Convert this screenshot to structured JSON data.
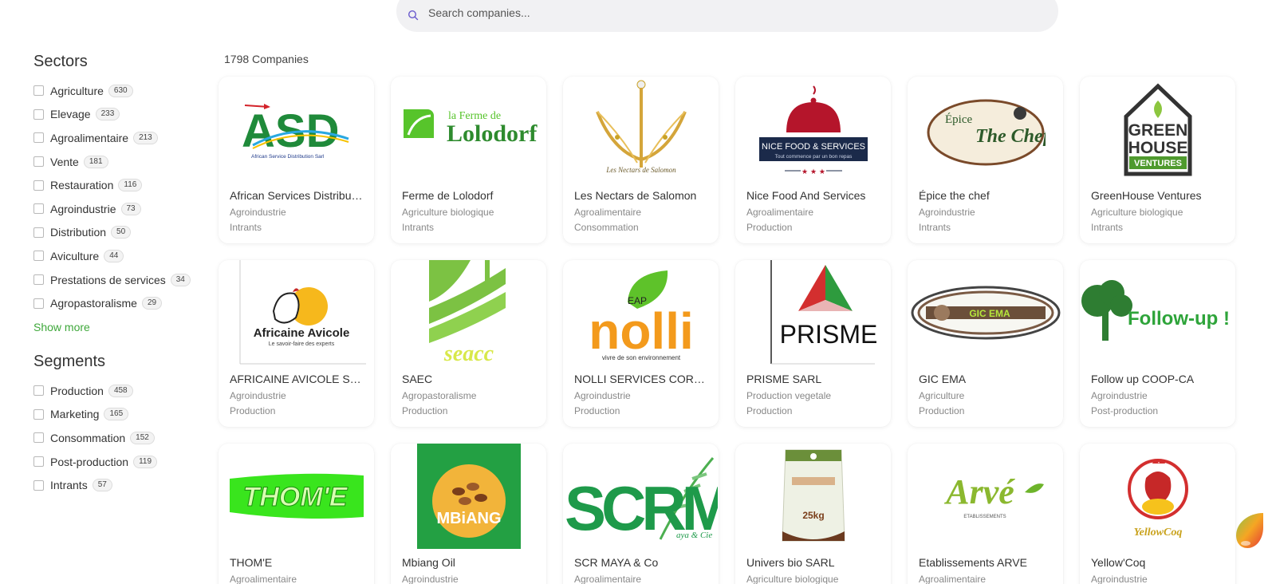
{
  "search": {
    "placeholder": "Search companies..."
  },
  "sidebar": {
    "sectors_title": "Sectors",
    "sectors": [
      {
        "label": "Agriculture",
        "count": "630"
      },
      {
        "label": "Elevage",
        "count": "233"
      },
      {
        "label": "Agroalimentaire",
        "count": "213"
      },
      {
        "label": "Vente",
        "count": "181"
      },
      {
        "label": "Restauration",
        "count": "116"
      },
      {
        "label": "Agroindustrie",
        "count": "73"
      },
      {
        "label": "Distribution",
        "count": "50"
      },
      {
        "label": "Aviculture",
        "count": "44"
      },
      {
        "label": "Prestations de services",
        "count": "34"
      },
      {
        "label": "Agropastoralisme",
        "count": "29"
      }
    ],
    "show_more": "Show more",
    "segments_title": "Segments",
    "segments": [
      {
        "label": "Production",
        "count": "458"
      },
      {
        "label": "Marketing",
        "count": "165"
      },
      {
        "label": "Consommation",
        "count": "152"
      },
      {
        "label": "Post-production",
        "count": "119"
      },
      {
        "label": "Intrants",
        "count": "57"
      }
    ]
  },
  "results": {
    "count_label": "1798 Companies"
  },
  "companies": [
    {
      "name": "African Services Distribution Sarl",
      "sector": "Agroindustrie",
      "segment": "Intrants",
      "logo": "asd-logo"
    },
    {
      "name": "Ferme de Lolodorf",
      "sector": "Agriculture biologique",
      "segment": "Intrants",
      "logo": "lolodorf-logo"
    },
    {
      "name": "Les Nectars de Salomon",
      "sector": "Agroalimentaire",
      "segment": "Consommation",
      "logo": "nectars-logo"
    },
    {
      "name": "Nice Food And Services",
      "sector": "Agroalimentaire",
      "segment": "Production",
      "logo": "nicefood-logo"
    },
    {
      "name": "Épice the chef",
      "sector": "Agroindustrie",
      "segment": "Intrants",
      "logo": "epice-logo"
    },
    {
      "name": "GreenHouse Ventures",
      "sector": "Agriculture biologique",
      "segment": "Intrants",
      "logo": "greenhouse-logo"
    },
    {
      "name": "AFRICAINE AVICOLE SARL",
      "sector": "Agroindustrie",
      "segment": "Production",
      "logo": "avicole-logo"
    },
    {
      "name": "SAEC",
      "sector": "Agropastoralisme",
      "segment": "Production",
      "logo": "saec-logo"
    },
    {
      "name": "NOLLI SERVICES CORPORATION",
      "sector": "Agroindustrie",
      "segment": "Production",
      "logo": "nolli-logo"
    },
    {
      "name": "PRISME SARL",
      "sector": "Production vegetale",
      "segment": "Production",
      "logo": "prisme-logo"
    },
    {
      "name": "GIC EMA",
      "sector": "Agriculture",
      "segment": "Production",
      "logo": "gicema-logo"
    },
    {
      "name": "Follow up COOP-CA",
      "sector": "Agroindustrie",
      "segment": "Post-production",
      "logo": "followup-logo"
    },
    {
      "name": "THOM'E",
      "sector": "Agroalimentaire",
      "segment": "",
      "logo": "thome-logo"
    },
    {
      "name": "Mbiang Oil",
      "sector": "Agroindustrie",
      "segment": "",
      "logo": "mbiang-logo"
    },
    {
      "name": "SCR MAYA & Co",
      "sector": "Agroalimentaire",
      "segment": "",
      "logo": "scrmaya-logo"
    },
    {
      "name": "Univers bio SARL",
      "sector": "Agriculture biologique",
      "segment": "",
      "logo": "universbio-logo"
    },
    {
      "name": "Etablissements ARVE",
      "sector": "Agroalimentaire",
      "segment": "",
      "logo": "arve-logo"
    },
    {
      "name": "Yellow'Coq",
      "sector": "Agroindustrie",
      "segment": "",
      "logo": "yellowcoq-logo"
    }
  ],
  "logo_text": {
    "asd": "ASD",
    "asd_sub": "African Service Distribution Sarl",
    "lolodorf_a": "la Ferme de",
    "lolodorf_b": "Lolodorf",
    "nectars": "Les Nectars de Salomon",
    "nicefood": "NICE FOOD & SERVICES",
    "nicefood_sub": "Tout commence par un bon repas",
    "epice_a": "Épice",
    "epice_b": "The Chef",
    "greenhouse_a": "GREEN",
    "greenhouse_b": "HOUSE",
    "greenhouse_c": "VENTURES",
    "avicole": "Africaine Avicole",
    "avicole_sub": "Le savoir-faire des experts",
    "saec": "seacc",
    "nolli": "nolli",
    "nolli_eap": "EAP",
    "nolli_sub": "vivre de son environnement",
    "prisme": "PRISME",
    "gicema": "GIC EMA",
    "followup": "Follow-up !",
    "thome": "THOM'E",
    "mbiang": "MBiANG",
    "scr": "SCRM",
    "scr_sub": "aya & Cie",
    "universbio": "25kg",
    "arve": "Arvé",
    "arve_sub": "ETABLISSEMENTS",
    "yellowcoq": "YellowCoq"
  },
  "colors": {
    "accent_green": "#3fa83b",
    "brand_red": "#b5152b",
    "navy": "#1b2a4a"
  }
}
